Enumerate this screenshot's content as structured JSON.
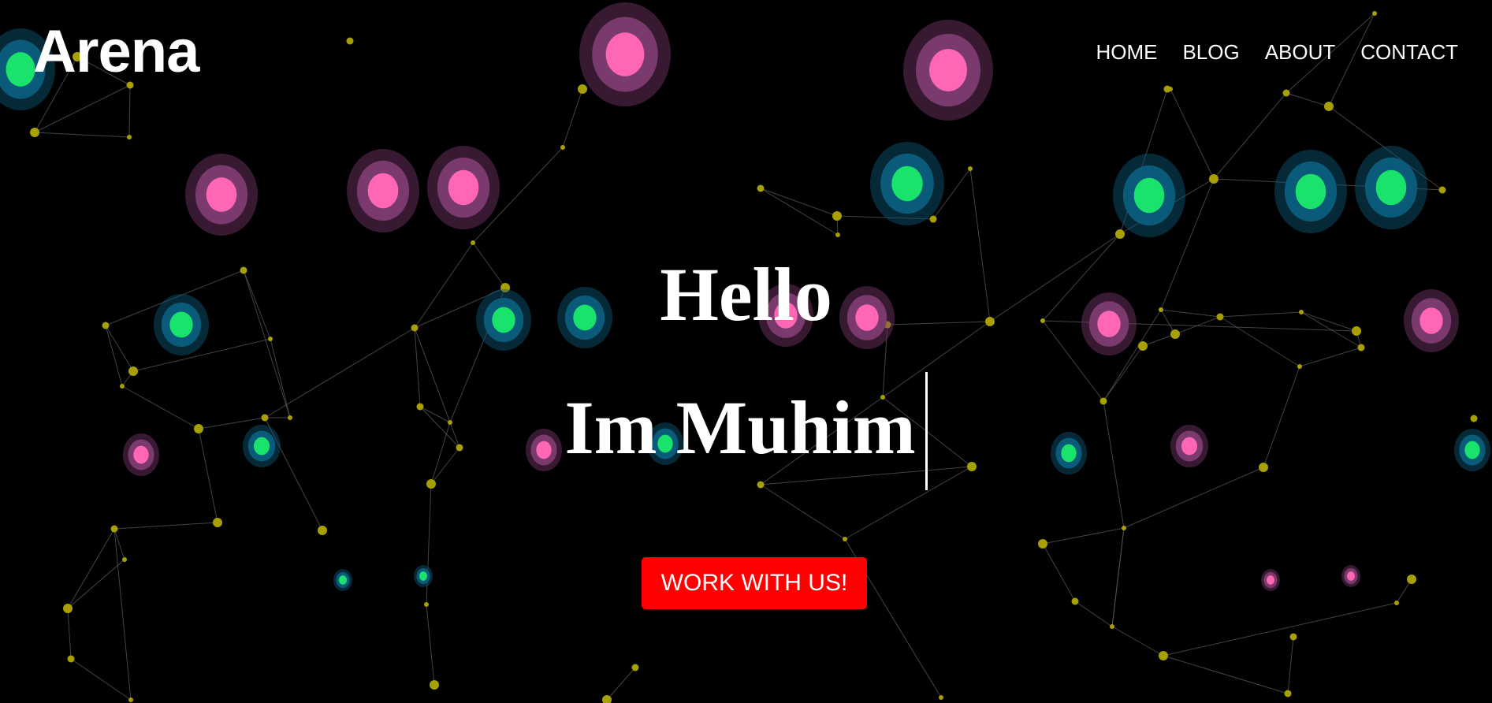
{
  "brand": {
    "logo_text": "Arena"
  },
  "nav": {
    "items": [
      {
        "label": "HOME"
      },
      {
        "label": "BLOG"
      },
      {
        "label": "ABOUT"
      },
      {
        "label": "CONTACT"
      }
    ]
  },
  "hero": {
    "greeting": "Hello",
    "typed_text": "Im Muhim",
    "cta_label": "WORK WITH US!"
  },
  "colors": {
    "background": "#000000",
    "cta": "#ff0000",
    "node_yellow": "#a8a000",
    "orb_green": "#19e36a",
    "orb_teal_ring": "#0a5a7a",
    "orb_pink": "#ff66b3",
    "orb_pink_ring": "#7a3a6e",
    "line": "#5a5a5a"
  }
}
